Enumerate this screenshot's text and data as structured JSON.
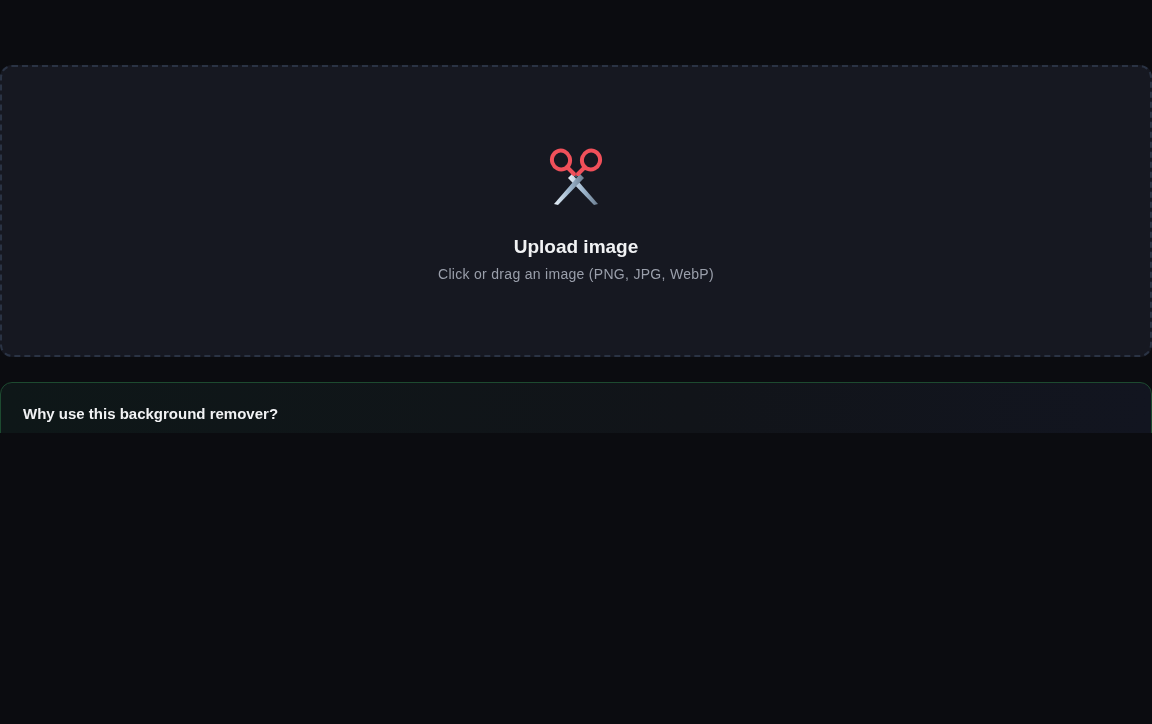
{
  "upload": {
    "title": "Upload image",
    "hint": "Click or drag an image (PNG, JPG, WebP)"
  },
  "info_card": {
    "title": "Why use this background remover?"
  }
}
